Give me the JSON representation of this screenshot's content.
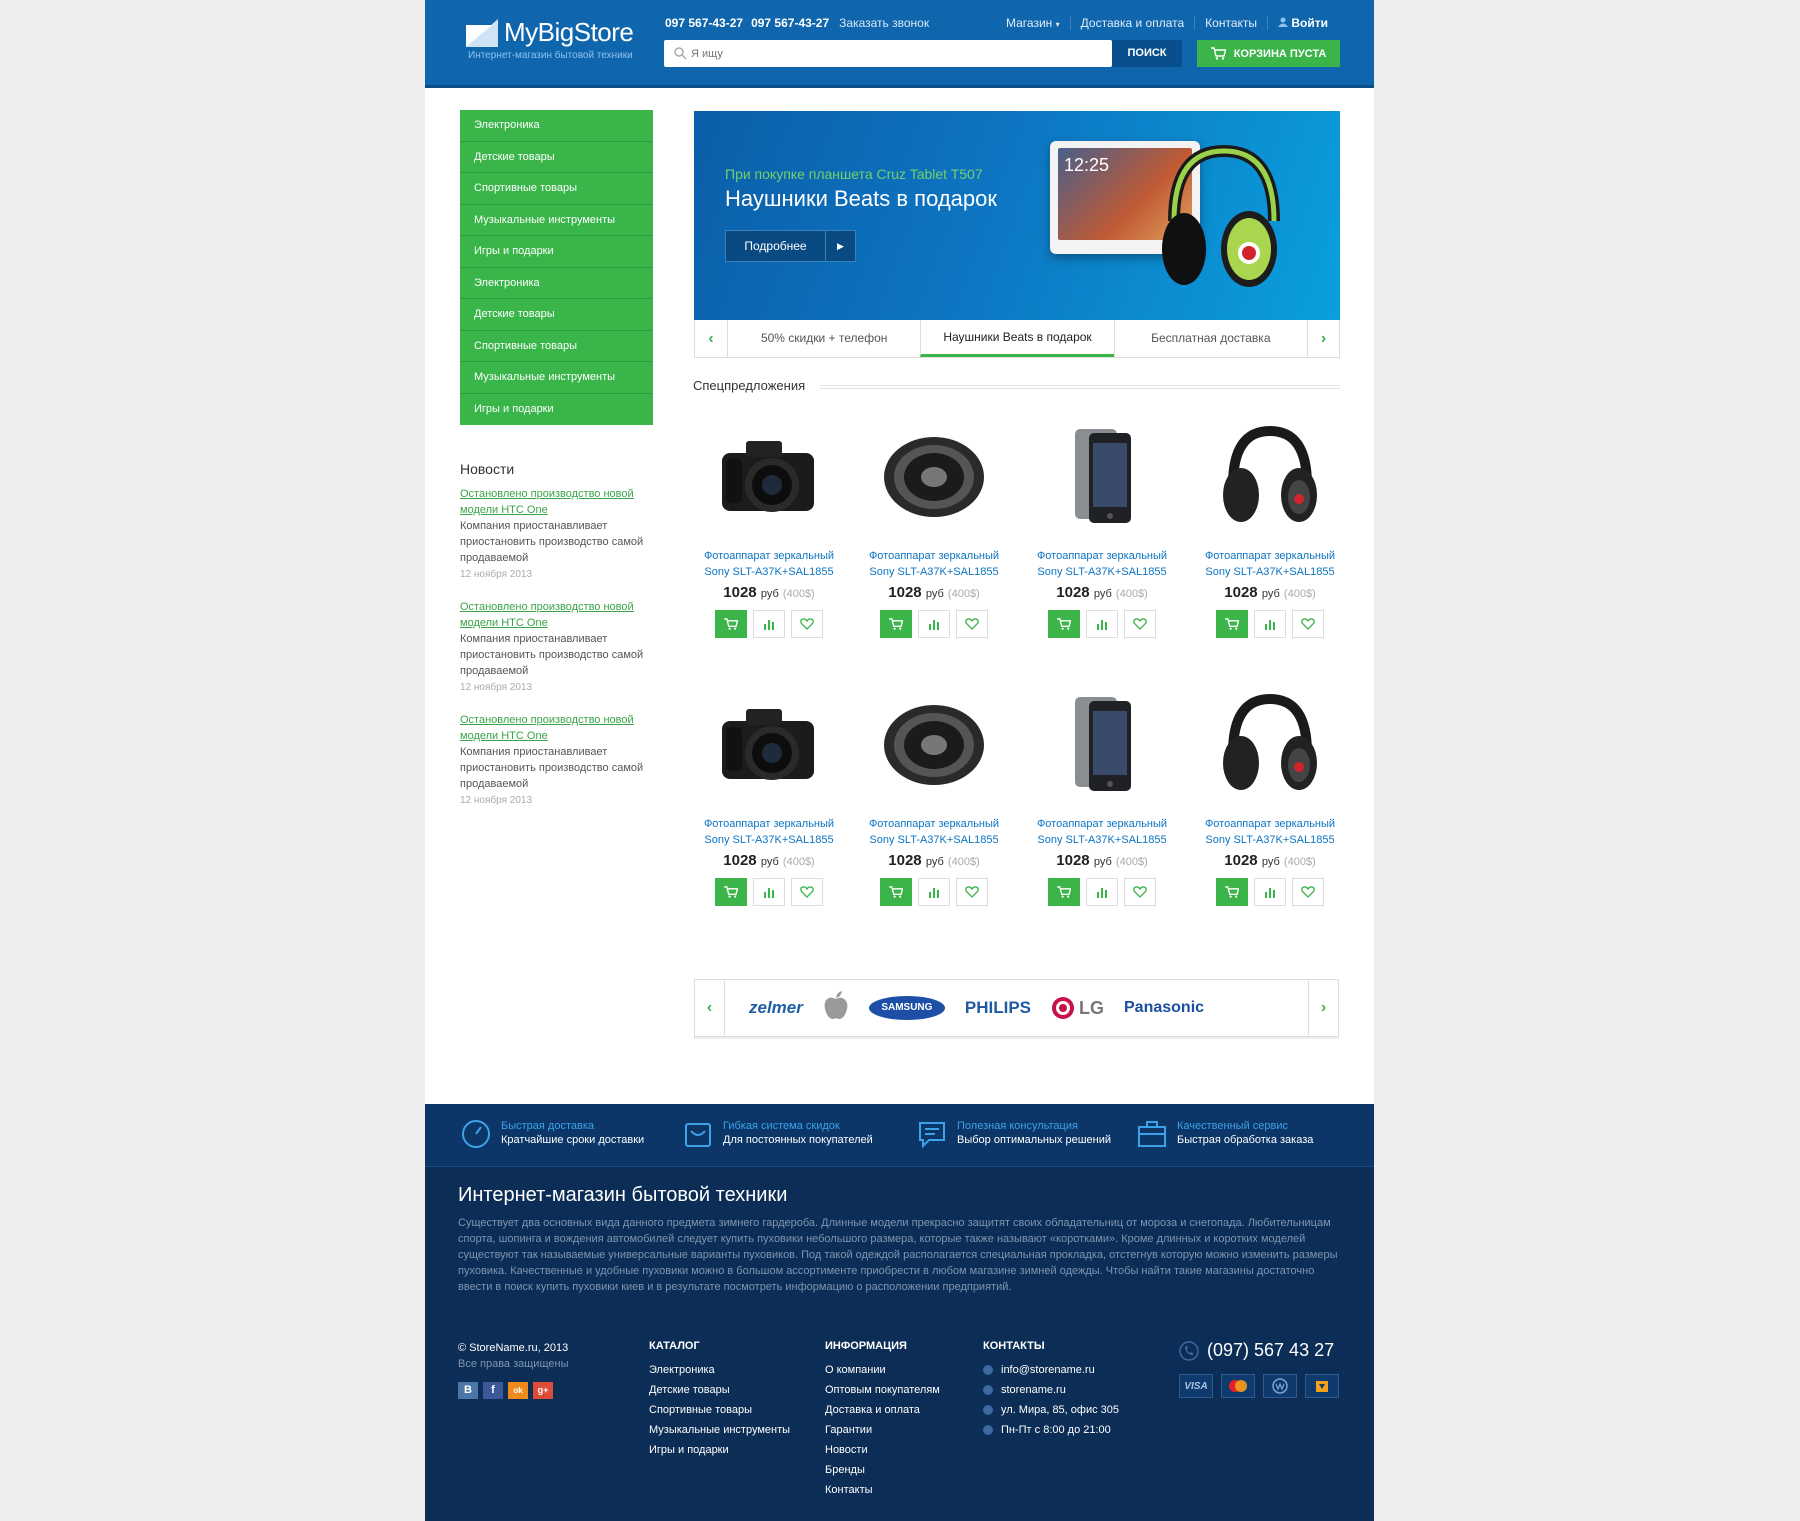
{
  "header": {
    "logo_title": "MyBigStore",
    "logo_tagline": "Интернет-магазин бытовой техники",
    "phone1": "097 567-43-27",
    "phone2": "097 567-43-27",
    "callback": "Заказать звонок",
    "nav": [
      "Магазин",
      "Доставка и оплата",
      "Контакты"
    ],
    "login": "Войти",
    "search_placeholder": "Я ищу",
    "search_button": "ПОИСК",
    "cart_label": "КОРЗИНА ПУСТА"
  },
  "sidebar": {
    "categories": [
      "Электроника",
      "Детские товары",
      "Спортивные товары",
      "Музыкальные инструменты",
      "Игры и подарки",
      "Электроника",
      "Детские товары",
      "Спортивные товары",
      "Музыкальные инструменты",
      "Игры и подарки"
    ],
    "news_title": "Новости",
    "news": [
      {
        "link": "Остановлено производство новой модели HTC One",
        "text": "Компания приостанавливает приостановить производство самой продаваемой",
        "date": "12 ноября 2013"
      },
      {
        "link": "Остановлено производство новой модели HTC One",
        "text": "Компания приостанавливает приостановить производство самой продаваемой",
        "date": "12 ноября 2013"
      },
      {
        "link": "Остановлено производство новой модели HTC One",
        "text": "Компания приостанавливает приостановить производство самой продаваемой",
        "date": "12 ноября 2013"
      }
    ]
  },
  "banner": {
    "subtitle": "При покупке планшета Cruz Tablet T507",
    "title": "Наушники Beats в подарок",
    "button": "Подробнее",
    "tablet_time": "12:25",
    "tabs": [
      "50% скидки + телефон",
      "Наушники Beats  в подарок",
      "Бесплатная доставка"
    ]
  },
  "offers": {
    "title": "Спецпредложения",
    "products": [
      {
        "kind": "camera",
        "name": "Фотоаппарат зеркальный Sony SLT-A37K+SAL1855",
        "price": "1028",
        "currency": "руб",
        "usd": "(400$)"
      },
      {
        "kind": "speaker",
        "name": "Фотоаппарат зеркальный Sony SLT-A37K+SAL1855",
        "price": "1028",
        "currency": "руб",
        "usd": "(400$)"
      },
      {
        "kind": "phone",
        "name": "Фотоаппарат зеркальный Sony SLT-A37K+SAL1855",
        "price": "1028",
        "currency": "руб",
        "usd": "(400$)"
      },
      {
        "kind": "headphones",
        "name": "Фотоаппарат зеркальный Sony SLT-A37K+SAL1855",
        "price": "1028",
        "currency": "руб",
        "usd": "(400$)"
      },
      {
        "kind": "camera",
        "name": "Фотоаппарат зеркальный Sony SLT-A37K+SAL1855",
        "price": "1028",
        "currency": "руб",
        "usd": "(400$)"
      },
      {
        "kind": "speaker",
        "name": "Фотоаппарат зеркальный Sony SLT-A37K+SAL1855",
        "price": "1028",
        "currency": "руб",
        "usd": "(400$)"
      },
      {
        "kind": "phone",
        "name": "Фотоаппарат зеркальный Sony SLT-A37K+SAL1855",
        "price": "1028",
        "currency": "руб",
        "usd": "(400$)"
      },
      {
        "kind": "headphones",
        "name": "Фотоаппарат зеркальный Sony SLT-A37K+SAL1855",
        "price": "1028",
        "currency": "руб",
        "usd": "(400$)"
      }
    ]
  },
  "brands": [
    "zelmer",
    "apple",
    "SAMSUNG",
    "PHILIPS",
    "LG",
    "Panasonic"
  ],
  "footer": {
    "features": [
      {
        "title": "Быстрая доставка",
        "text": "Кратчайшие сроки доставки"
      },
      {
        "title": "Гибкая система скидок",
        "text": "Для постоянных покупателей"
      },
      {
        "title": "Полезная консультация",
        "text": "Выбор оптимальных решений"
      },
      {
        "title": "Качественный сервис",
        "text": "Быстрая обработка заказа"
      }
    ],
    "title": "Интернет-магазин бытовой техники",
    "text": "Существует два основных вида данного предмета зимнего гардероба. Длинные модели прекрасно защитят своих обладательниц от мороза и снегопада. Любительницам спорта, шопинга и вождения автомобилей следует купить пуховики небольшого размера, которые также называют «коротками». Кроме длинных и коротких моделей существуют так называемые универсальные варианты пуховиков. Под такой одеждой располагается специальная прокладка, отстегнув которую можно изменить размеры пуховика. Качественные и удобные пуховики можно в большом ассортименте приобрести в любом магазине зимней одежды. Чтобы найти такие магазины достаточно ввести в поиск купить пуховики киев и в результате посмотреть информацию о расположении предприятий.",
    "copyright": "© StoreName.ru, 2013",
    "rights": "Все права защищены",
    "socials": [
      "B",
      "f",
      "ok",
      "g+"
    ],
    "catalog_title": "КАТАЛОГ",
    "catalog": [
      "Электроника",
      "Детские товары",
      "Спортивные товары",
      "Музыкальные инструменты",
      "Игры и подарки"
    ],
    "info_title": "ИНФОРМАЦИЯ",
    "info": [
      "О компании",
      "Оптовым покупателям",
      "Доставка и оплата",
      "Гарантии",
      "Новости",
      "Бренды",
      "Контакты"
    ],
    "contacts_title": "КОНТАКТЫ",
    "contacts": [
      "info@storename.ru",
      "storename.ru",
      "ул. Мира, 85, офис 305",
      "Пн-Пт с 8:00 до 21:00"
    ],
    "phone": "(097) 567 43 27",
    "payments": [
      "VISA",
      "MC",
      "WM",
      "YM"
    ]
  },
  "colors": {
    "brand_blue": "#0f66ad",
    "accent_green": "#3bb44a",
    "footer_navy": "#0c2d55",
    "link_blue": "#0d75c3"
  }
}
